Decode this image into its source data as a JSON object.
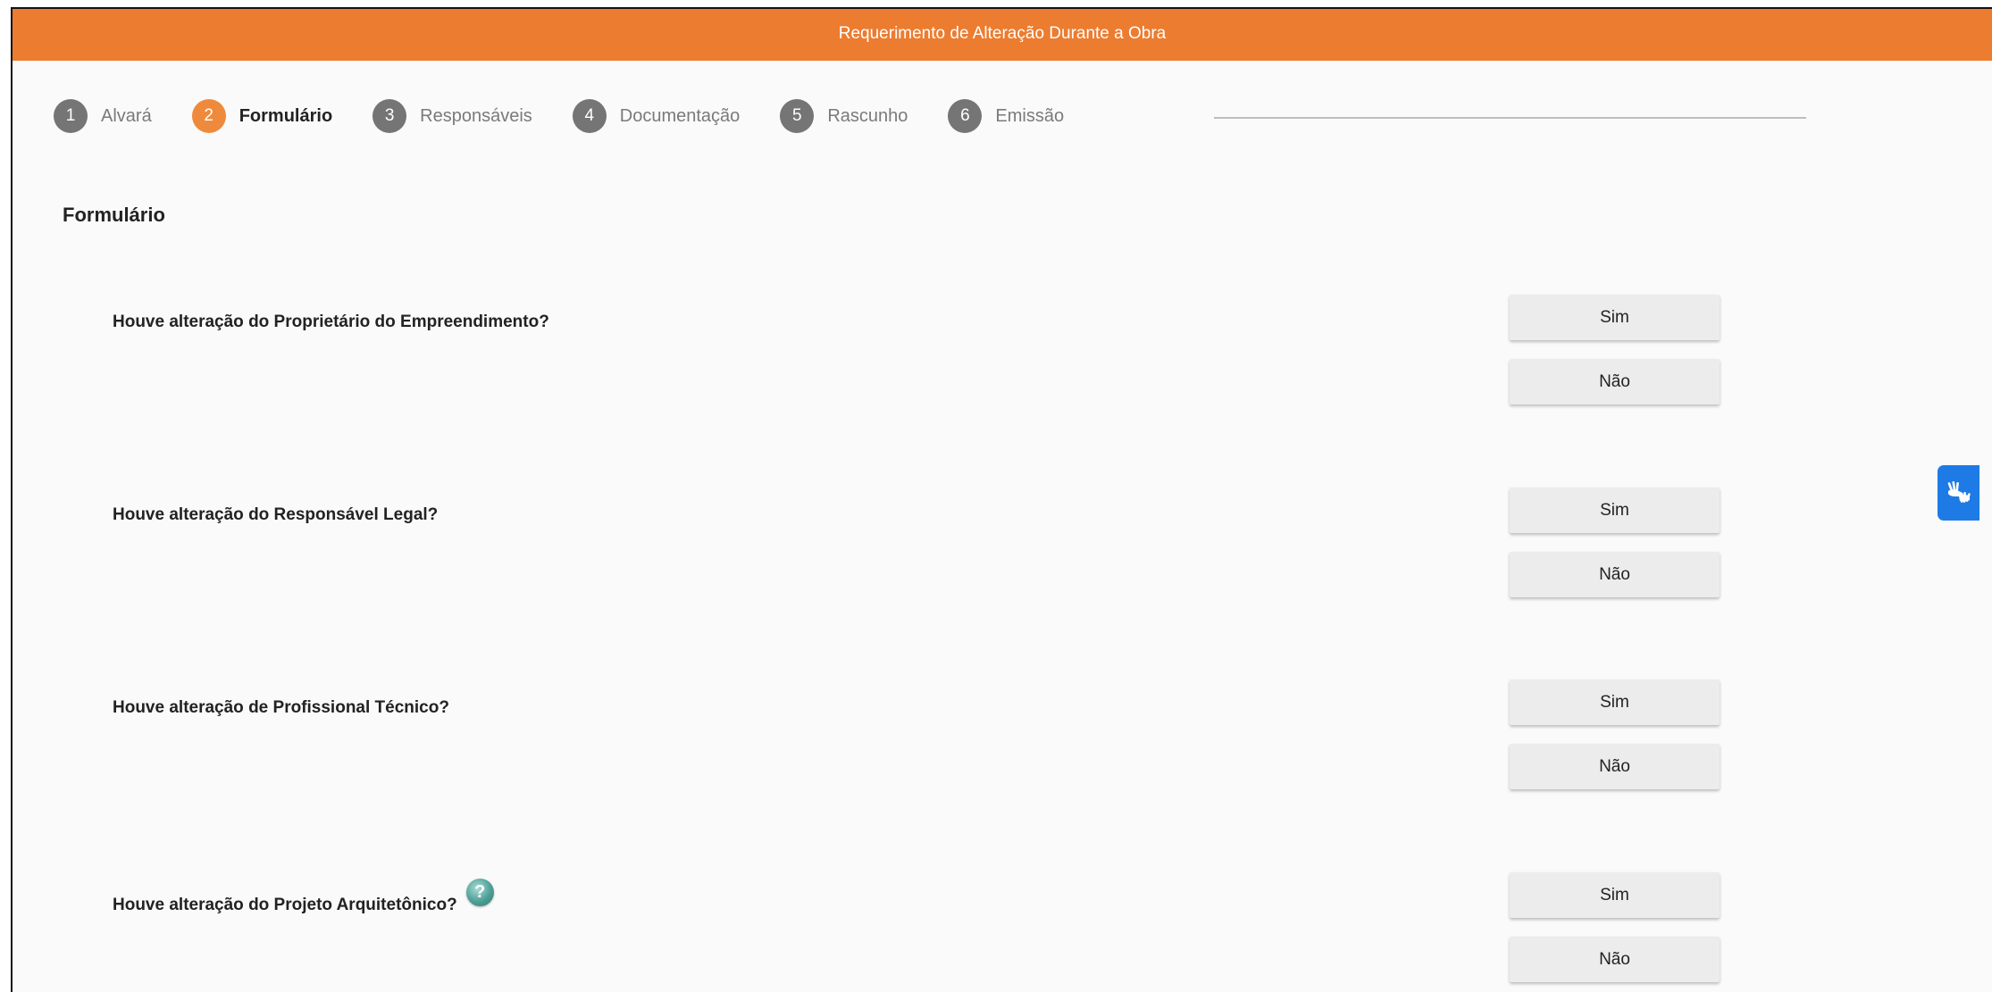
{
  "window": {
    "title": "Requerimento de Alteração Durante a Obra"
  },
  "steps": [
    {
      "num": "1",
      "label": "Alvará"
    },
    {
      "num": "2",
      "label": "Formulário"
    },
    {
      "num": "3",
      "label": "Responsáveis"
    },
    {
      "num": "4",
      "label": "Documentação"
    },
    {
      "num": "5",
      "label": "Rascunho"
    },
    {
      "num": "6",
      "label": "Emissão"
    }
  ],
  "active_step": 2,
  "section": {
    "title": "Formulário"
  },
  "questions": [
    {
      "text": "Houve alteração do Proprietário do Empreendimento?",
      "yes": "Sim",
      "no": "Não"
    },
    {
      "text": "Houve alteração do Responsável Legal?",
      "yes": "Sim",
      "no": "Não"
    },
    {
      "text": "Houve alteração de Profissional Técnico?",
      "yes": "Sim",
      "no": "Não"
    },
    {
      "text": "Houve alteração do Projeto Arquitetônico?",
      "yes": "Sim",
      "no": "Não",
      "help_icon": "question-help-icon"
    }
  ],
  "accessibility": {
    "icon": "sign-language-hands-icon"
  },
  "colors": {
    "header": "#ec7c30",
    "active_step": "#ef8a3c",
    "inactive_step": "#757575",
    "accessibility": "#1e7be6"
  }
}
